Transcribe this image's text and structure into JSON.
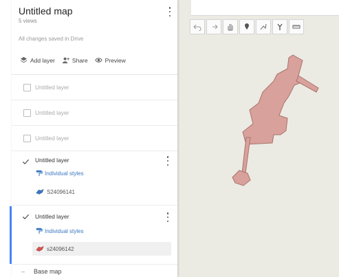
{
  "map": {
    "title": "Untitled map",
    "views": "5 views",
    "saved_status": "All changes saved in Drive"
  },
  "actions": {
    "add_layer": "Add layer",
    "share": "Share",
    "preview": "Preview"
  },
  "layers": [
    {
      "name": "Untitled layer",
      "checked": false
    },
    {
      "name": "Untitled layer",
      "checked": false
    },
    {
      "name": "Untitled layer",
      "checked": false
    },
    {
      "name": "Untitled layer",
      "checked": true,
      "style_label": "Individual styles",
      "data_label": "S24096141"
    },
    {
      "name": "Untitled layer",
      "checked": true,
      "style_label": "Individual styles",
      "data_label": "s24096142",
      "selected": true
    }
  ],
  "base_map": {
    "label": "Base map"
  },
  "toolbar": {
    "tools": [
      "undo-icon",
      "redo-icon",
      "hand-icon",
      "marker-icon",
      "draw-line-icon",
      "directions-icon",
      "ruler-icon"
    ]
  },
  "colors": {
    "map_bg": "#ebeae3",
    "shape_fill": "#d9a19b",
    "shape_stroke": "#a8726c",
    "accent": "#4285f4",
    "link": "#3a78c2"
  }
}
